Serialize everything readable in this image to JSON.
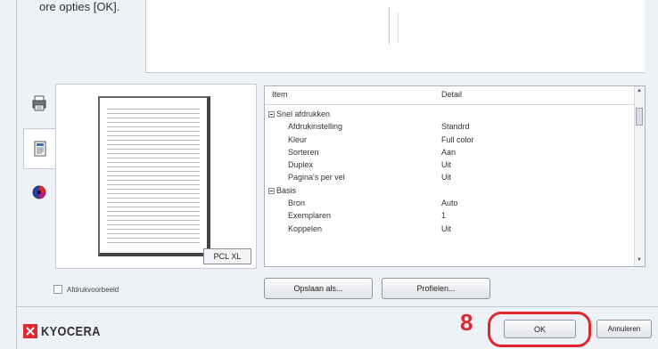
{
  "top_text": "ore opties [OK].",
  "tabs": [
    {
      "name": "printer-icon",
      "active": false
    },
    {
      "name": "document-icon",
      "active": true
    },
    {
      "name": "color-icon",
      "active": false
    }
  ],
  "preview": {
    "badge": "PCL XL"
  },
  "table": {
    "col_item": "Item",
    "col_detail": "Detail",
    "rows": [
      {
        "group": true,
        "item": "Snel afdrukken",
        "detail": ""
      },
      {
        "group": false,
        "item": "Afdrukinstelling",
        "detail": "Standrd"
      },
      {
        "group": false,
        "item": "Kleur",
        "detail": "Full color"
      },
      {
        "group": false,
        "item": "Sorteren",
        "detail": "Aan"
      },
      {
        "group": false,
        "item": "Duplex",
        "detail": "Uit"
      },
      {
        "group": false,
        "item": "Pagina's per vel",
        "detail": "Uit"
      },
      {
        "group": true,
        "item": "Basis",
        "detail": ""
      },
      {
        "group": false,
        "item": "Bron",
        "detail": "Auto"
      },
      {
        "group": false,
        "item": "Exemplaren",
        "detail": "1"
      },
      {
        "group": false,
        "item": "Koppelen",
        "detail": "Uit"
      }
    ]
  },
  "checkbox_label": "Afdrukvoorbeeld",
  "buttons": {
    "save_as": "Opslaan als...",
    "profiles": "Profielen...",
    "ok": "OK",
    "cancel": "Annuleren"
  },
  "logo_text": "KYOCERA",
  "callout_number": "8",
  "colors": {
    "accent_red": "#e0262e",
    "kyocera_red": "#e0262e"
  }
}
